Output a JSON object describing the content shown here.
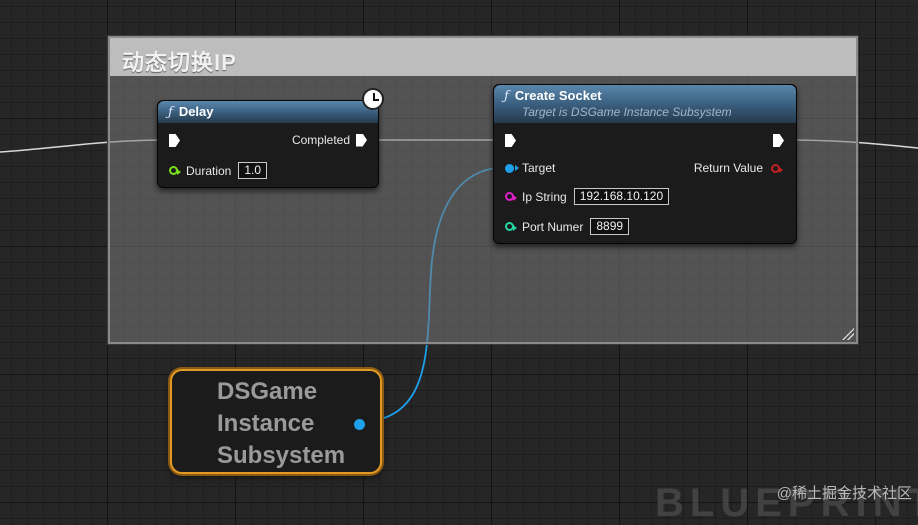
{
  "comment": {
    "title": "动态切换IP"
  },
  "delay_node": {
    "title": "Delay",
    "completed_label": "Completed",
    "duration_label": "Duration",
    "duration_value": "1.0"
  },
  "create_socket_node": {
    "title": "Create Socket",
    "subtitle": "Target is DSGame Instance Subsystem",
    "target_label": "Target",
    "return_label": "Return Value",
    "ip_label": "Ip String",
    "ip_value": "192.168.10.120",
    "port_label": "Port Numer",
    "port_value": "8899"
  },
  "variable_node": {
    "lines": [
      "DSGame",
      "Instance",
      "Subsystem"
    ]
  },
  "background_text": "BLUEPRINT",
  "watermark": "@稀土掘金技术社区",
  "colors": {
    "object_pin": "#1ea0ea",
    "string_pin": "#e020c8",
    "float_pin": "#7ae01a",
    "int_pin": "#25d6a0",
    "return_pin": "#c02020",
    "var_border": "#e39a24"
  },
  "icons": {
    "function": "function-icon",
    "latent": "clock-icon"
  }
}
